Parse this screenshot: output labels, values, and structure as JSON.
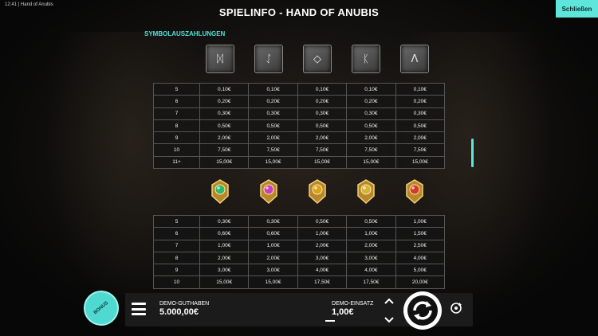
{
  "status": {
    "clock": "12:41 | Hand of Anubis"
  },
  "header": {
    "title": "SPIELINFO - HAND OF ANUBIS",
    "close_label": "Schließen"
  },
  "section": {
    "title": "SYMBOLAUSZAHLUNGEN"
  },
  "table1": {
    "symbols": [
      {
        "name": "rune-10-icon",
        "glyph": "ᛞ"
      },
      {
        "name": "rune-j-icon",
        "glyph": "ᛇ"
      },
      {
        "name": "rune-q-icon",
        "glyph": "◇"
      },
      {
        "name": "rune-k-icon",
        "glyph": "ᛕ"
      },
      {
        "name": "rune-a-icon",
        "glyph": "Λ"
      }
    ],
    "rows": [
      [
        "5",
        "0,10€",
        "0,10€",
        "0,10€",
        "0,10€",
        "0,10€"
      ],
      [
        "6",
        "0,20€",
        "0,20€",
        "0,20€",
        "0,20€",
        "0,20€"
      ],
      [
        "7",
        "0,30€",
        "0,30€",
        "0,30€",
        "0,30€",
        "0,30€"
      ],
      [
        "8",
        "0,50€",
        "0,50€",
        "0,50€",
        "0,50€",
        "0,50€"
      ],
      [
        "9",
        "2,00€",
        "2,00€",
        "2,00€",
        "2,00€",
        "2,00€"
      ],
      [
        "10",
        "7,50€",
        "7,50€",
        "7,50€",
        "7,50€",
        "7,50€"
      ],
      [
        "11+",
        "15,00€",
        "15,00€",
        "15,00€",
        "15,00€",
        "15,00€"
      ]
    ]
  },
  "table2": {
    "symbols": [
      {
        "name": "green-amulet-icon",
        "color": "#2fb86a"
      },
      {
        "name": "pink-scarab-icon",
        "color": "#c83fb8"
      },
      {
        "name": "eye-pyramid-icon",
        "color": "#d8a21c"
      },
      {
        "name": "winged-gem-icon",
        "color": "#d2b437"
      },
      {
        "name": "ankh-icon",
        "color": "#d33a2a"
      }
    ],
    "rows": [
      [
        "5",
        "0,30€",
        "0,30€",
        "0,50€",
        "0,50€",
        "1,00€"
      ],
      [
        "6",
        "0,60€",
        "0,60€",
        "1,00€",
        "1,00€",
        "1,50€"
      ],
      [
        "7",
        "1,00€",
        "1,00€",
        "2,00€",
        "2,00€",
        "2,50€"
      ],
      [
        "8",
        "2,00€",
        "2,00€",
        "3,00€",
        "3,00€",
        "4,00€"
      ],
      [
        "9",
        "3,00€",
        "3,00€",
        "4,00€",
        "4,00€",
        "5,00€"
      ],
      [
        "10",
        "15,00€",
        "15,00€",
        "17,50€",
        "17,50€",
        "20,00€"
      ]
    ]
  },
  "footer": {
    "bonus_label": "BONUS",
    "balance_label": "DEMO-GUTHABEN",
    "balance_value": "5.000,00€",
    "stake_label": "DEMO-EINSATZ",
    "stake_value": "1,00€"
  },
  "colors": {
    "accent": "#5fe6dc",
    "section": "#4fe0d8"
  }
}
